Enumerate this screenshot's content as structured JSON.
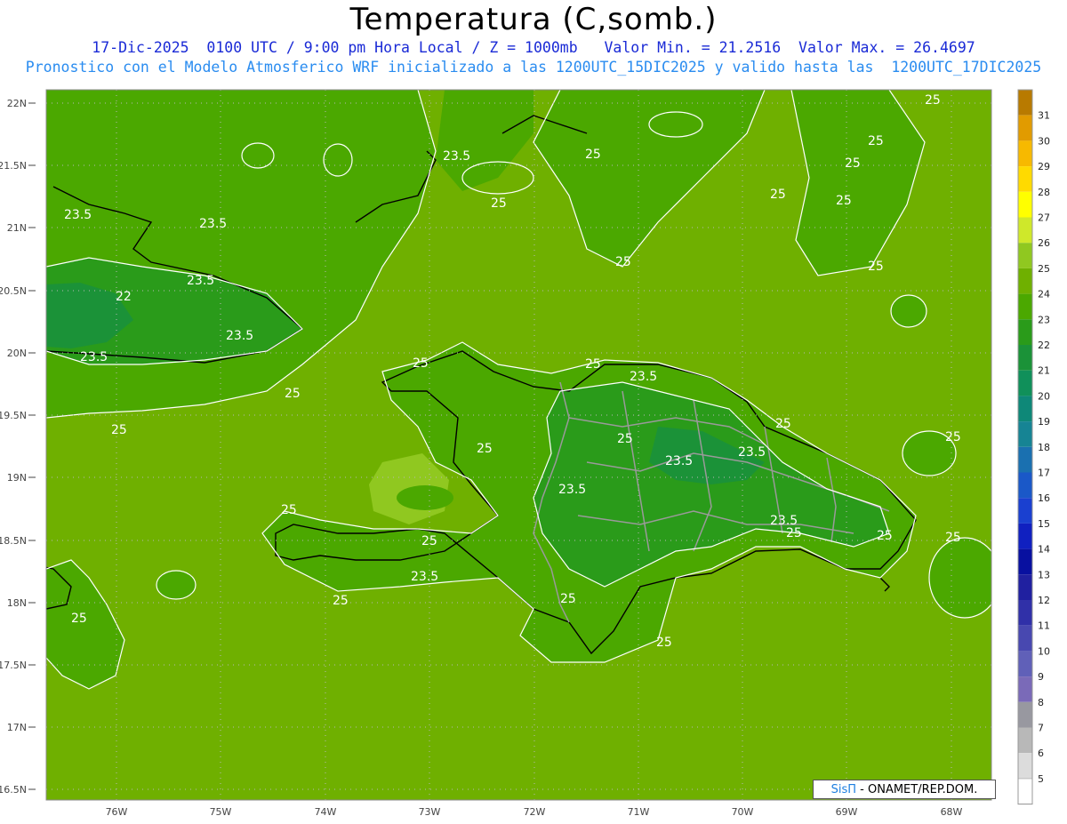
{
  "header": {
    "title": "Temperatura (C,somb.)",
    "line1": "17-Dic-2025  0100 UTC / 9:00 pm Hora Local / Z = 1000mb   Valor Min. = 21.2516  Valor Max. = 26.4697",
    "line2": "Pronostico con el Modelo Atmosferico WRF inicializado a las 1200UTC_15DIC2025 y valido hasta las  1200UTC_17DIC2025"
  },
  "axes": {
    "lat_labels": [
      "22N",
      "21.5N",
      "21N",
      "20.5N",
      "20N",
      "19.5N",
      "19N",
      "18.5N",
      "18N",
      "17.5N",
      "17N",
      "16.5N"
    ],
    "lon_labels": [
      "76W",
      "75W",
      "74W",
      "73W",
      "72W",
      "71W",
      "70W",
      "69W",
      "68W"
    ]
  },
  "contour_labels": [
    "23.5",
    "23.5",
    "23.5",
    "23.5",
    "23.5",
    "22",
    "25",
    "25",
    "25",
    "25",
    "25",
    "25",
    "25",
    "25",
    "25",
    "25",
    "25",
    "25",
    "23.5",
    "23.5",
    "25",
    "25",
    "25",
    "23.5",
    "23.5",
    "25",
    "23.5",
    "25",
    "23.5",
    "25",
    "25",
    "25",
    "25",
    "25",
    "25",
    "25"
  ],
  "colorbar": {
    "levels": [
      "31",
      "30",
      "29",
      "28",
      "27",
      "26",
      "25",
      "24",
      "23",
      "22",
      "21",
      "20",
      "19",
      "18",
      "17",
      "16",
      "15",
      "14",
      "13",
      "12",
      "11",
      "10",
      "9",
      "8",
      "7",
      "6",
      "5"
    ],
    "colors": [
      "#b87a00",
      "#e19b00",
      "#f7b900",
      "#ffda00",
      "#ffff00",
      "#cfe82a",
      "#90c820",
      "#6fb000",
      "#4ba800",
      "#2a9b1a",
      "#1b9238",
      "#10905a",
      "#0e8878",
      "#168494",
      "#1a70b0",
      "#1a58c8",
      "#1a40d0",
      "#1020c0",
      "#0810a0",
      "#2020a0",
      "#3030a8",
      "#4848b0",
      "#6060b8",
      "#7a6ab8",
      "#9898a0",
      "#b8b8b8",
      "#dcdcdc"
    ],
    "bottom_color": "#ffffff"
  },
  "colors": {
    "sea": "#6fb000",
    "land_24": "#4ba800",
    "land_23": "#2a9b1a",
    "cool_22": "#1b9238",
    "warm_26": "#90c820"
  },
  "credit": {
    "brand": "SisΠ",
    "text": " - ONAMET/REP.DOM."
  }
}
